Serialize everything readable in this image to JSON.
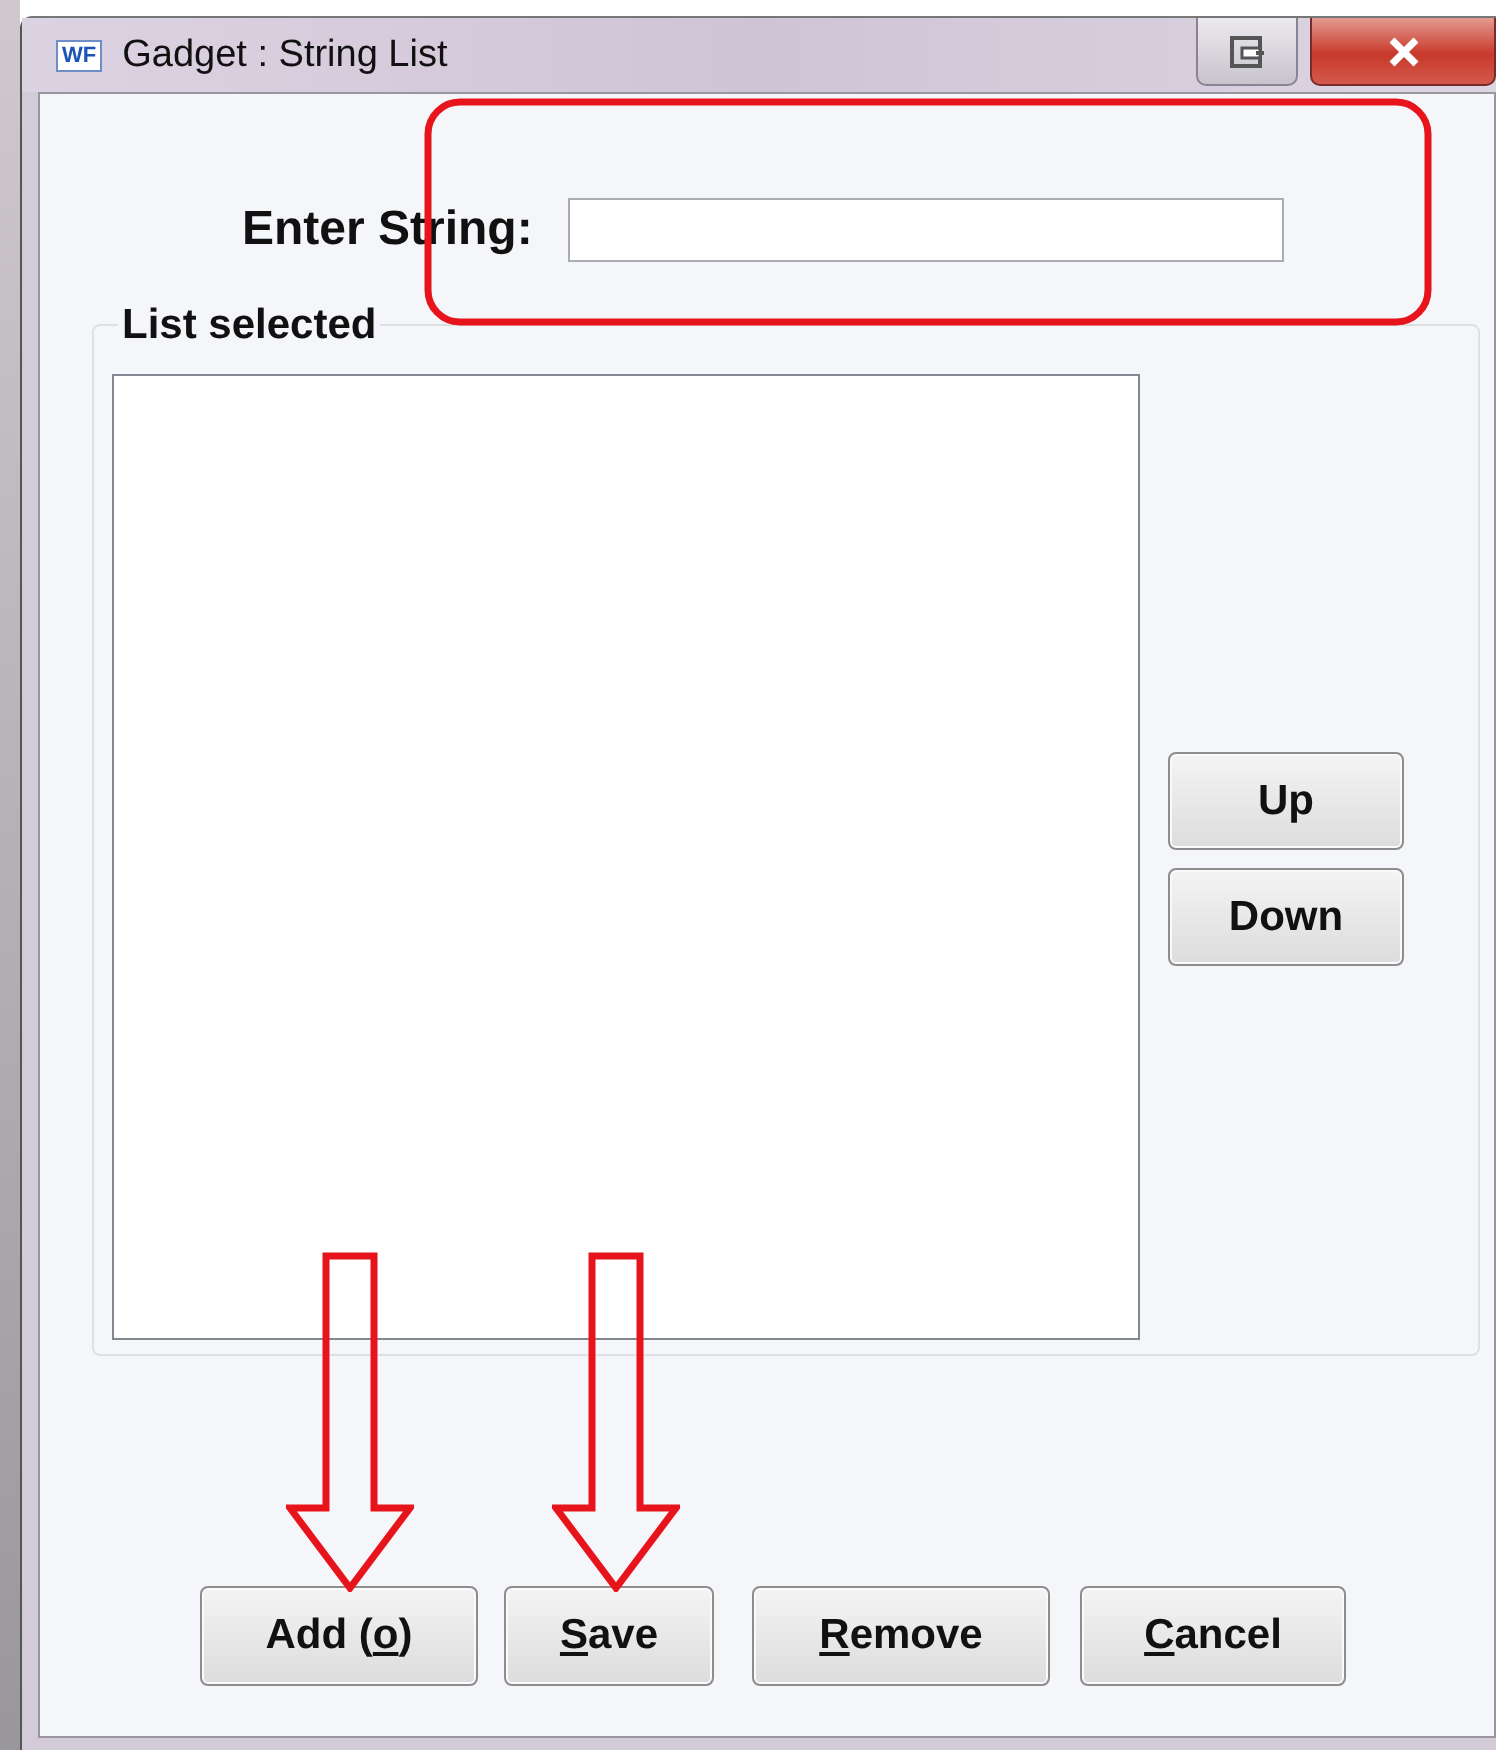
{
  "window": {
    "title": "Gadget : String List",
    "icon_text": "WF"
  },
  "string_field": {
    "label": "Enter String:"
  },
  "list_group": {
    "title": "List selected"
  },
  "side_buttons": [
    {
      "before": "Up"
    },
    {
      "before": "Down"
    }
  ],
  "buttons": [
    {
      "before": "Add (",
      "key": "o",
      "after": ")"
    },
    {
      "key": "S",
      "after": "ave"
    },
    {
      "key": "R",
      "after": "emove"
    },
    {
      "key": "C",
      "after": "ancel"
    }
  ],
  "annotations": [
    {
      "kind": "frame"
    },
    {
      "kind": "arrow"
    },
    {
      "kind": "arrow"
    }
  ]
}
